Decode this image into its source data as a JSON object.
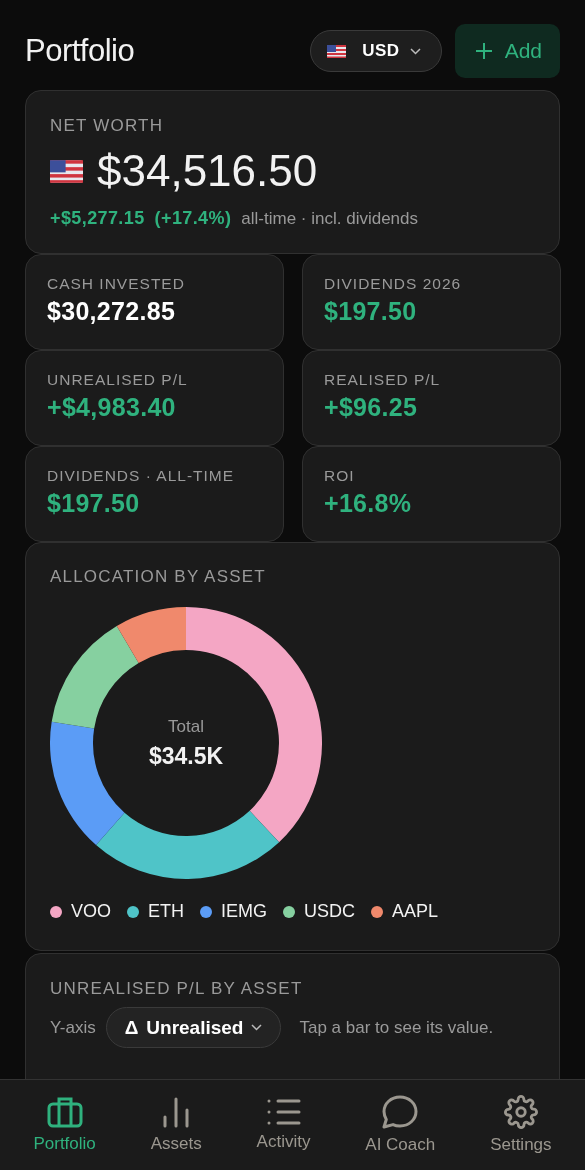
{
  "header": {
    "title": "Portfolio",
    "currency": {
      "label": "USD"
    },
    "add_button": {
      "label": "Add"
    }
  },
  "net_worth": {
    "label": "NET WORTH",
    "value": "$34,516.50",
    "change": "+$5,277.15",
    "change_pct": "(+17.4%)",
    "note": "all-time · incl. dividends"
  },
  "stats": [
    {
      "label": "CASH INVESTED",
      "value": "$30,272.85",
      "kind": "plain"
    },
    {
      "label": "DIVIDENDS 2026",
      "value": "$197.50",
      "kind": "gain"
    },
    {
      "label": "UNREALISED P/L",
      "value": "+$4,983.40",
      "kind": "gain"
    },
    {
      "label": "REALISED P/L",
      "value": "+$96.25",
      "kind": "gain"
    },
    {
      "label": "DIVIDENDS · ALL-TIME",
      "value": "$197.50",
      "kind": "gain"
    },
    {
      "label": "ROI",
      "value": "+16.8%",
      "kind": "gain"
    }
  ],
  "allocation": {
    "title": "ALLOCATION BY ASSET",
    "center_label": "Total",
    "center_value": "$34.5K",
    "legend": [
      {
        "label": "VOO",
        "color": "#f4a6c4"
      },
      {
        "label": "ETH",
        "color": "#4fc4c8"
      },
      {
        "label": "IEMG",
        "color": "#5b9cf6"
      },
      {
        "label": "USDC",
        "color": "#86d0a0"
      },
      {
        "label": "AAPL",
        "color": "#f0896c"
      }
    ]
  },
  "pl_chart": {
    "title": "UNREALISED P/L BY ASSET",
    "axis_label": "Y-axis",
    "selector": {
      "symbol": "Δ",
      "label": "Unrealised"
    },
    "hint": "Tap a bar to see its value."
  },
  "nav": [
    {
      "label": "Portfolio",
      "kind": "briefcase",
      "selected": true
    },
    {
      "label": "Assets",
      "kind": "bars",
      "selected": false
    },
    {
      "label": "Activity",
      "kind": "list",
      "selected": false
    },
    {
      "label": "AI Coach",
      "kind": "chat",
      "selected": false
    },
    {
      "label": "Settings",
      "kind": "gear",
      "selected": false
    }
  ]
}
